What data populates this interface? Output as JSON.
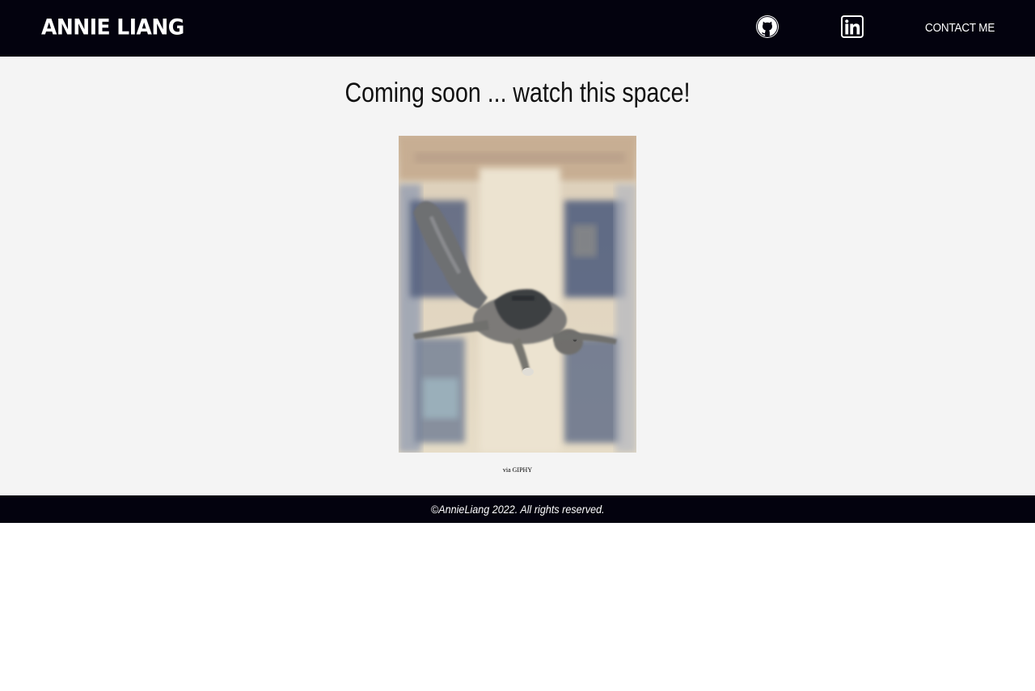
{
  "header": {
    "brand": "ANNIE LIANG",
    "github_icon": "github-icon",
    "linkedin_icon": "linkedin-icon",
    "contact_label": "CONTACT ME"
  },
  "main": {
    "heading": "Coming soon ... watch this space!",
    "gif_description": "flying-squirrel-gif",
    "credit_prefix": "via",
    "credit_link": "GIPHY"
  },
  "footer": {
    "copyright": "©AnnieLiang 2022. All rights reserved."
  },
  "colors": {
    "nav_background": "#03020e",
    "main_background": "#f4f4f4",
    "text_light": "#ffffff"
  }
}
